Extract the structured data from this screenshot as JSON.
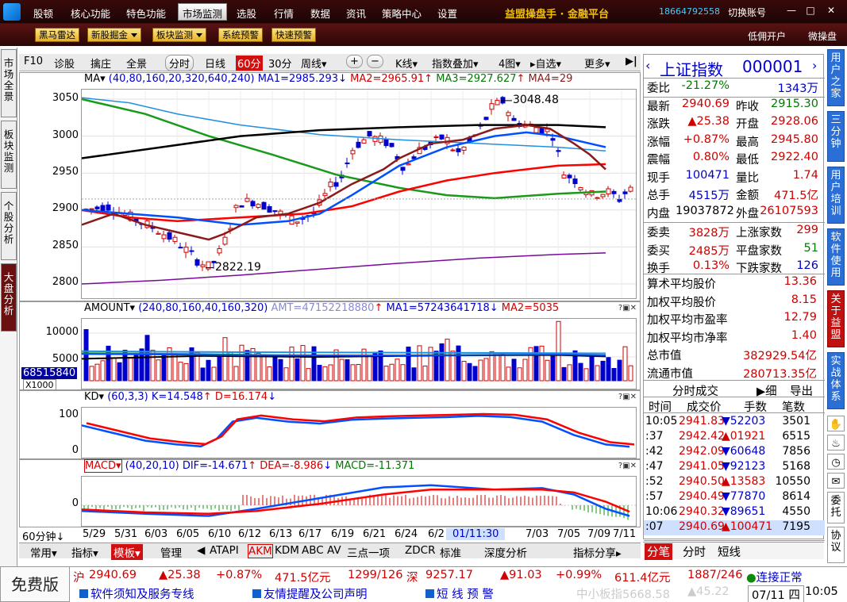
{
  "menu": {
    "items": [
      "行情",
      "核心功能",
      "特色功能",
      "市场监测",
      "选股",
      "行情",
      "数据",
      "资讯",
      "策略中心",
      "设置"
    ],
    "active_index": 3,
    "brand": "益盟操盘手 · 金融平台",
    "phone": "18664792558",
    "account": "切换账号",
    "first_label": "股顿"
  },
  "toolbar2": {
    "buttons": [
      "黑马雷达",
      "新股掘金",
      "板块监测",
      "系统预警",
      "快速预警"
    ],
    "right_links": [
      "低佣开户",
      "微操盘"
    ]
  },
  "left_tabs": [
    "市场全景",
    "板块监测",
    "个股分析",
    "大盘分析"
  ],
  "right_tabs": [
    "用户之家",
    "三分钟",
    "用户培训",
    "软件使用",
    "关于益盟",
    "实战体系",
    "委托",
    "协议"
  ],
  "chart_toolbar": {
    "items": [
      "F10",
      "诊股",
      "擒庄",
      "全景",
      "分时",
      "日线",
      "60分",
      "30分",
      "周线",
      "+",
      "−",
      "K线",
      "指数叠加",
      "4图",
      "自选",
      "更多"
    ],
    "active": "60分"
  },
  "main_panel": {
    "title_prefix": "MA",
    "params": "(40,80,160,20,320,640,240)",
    "ma_labels": [
      "MA1=2985.293",
      "MA2=2965.91",
      "MA3=2927.627",
      "MA4=29"
    ],
    "y_ticks": [
      "3050",
      "3000",
      "2950",
      "2900",
      "2850",
      "2800"
    ],
    "high_label": "3048.48",
    "low_label": "2822.19"
  },
  "amount_panel": {
    "title": "AMOUNT",
    "params": "(240,80,160,40,160,320)",
    "labels": [
      "AMT=47152218880",
      "MA1=57243641718",
      "MA2=5035"
    ],
    "y_ticks": [
      "10000",
      "5000"
    ],
    "unit_value": "68515840",
    "unit": "X1000"
  },
  "kd_panel": {
    "title": "KD",
    "params": "(60,3,3)",
    "labels": [
      "K=14.548",
      "D=16.174"
    ],
    "y_ticks": [
      "100",
      "0"
    ]
  },
  "macd_panel": {
    "title": "MACD",
    "params": "(40,20,10)",
    "labels": [
      "DIF=-14.671",
      "DEA=-8.986",
      "MACD=-11.371"
    ],
    "y_ticks": [
      "0"
    ]
  },
  "x_axis": {
    "period": "60分钟",
    "labels": [
      "5/29",
      "5/31",
      "6/03",
      "6/05",
      "6/10",
      "6/12",
      "6/13",
      "6/17",
      "6/19",
      "6/21",
      "6/24",
      "6/2",
      "01/11:30",
      "7/03",
      "7/05",
      "7/09",
      "7/11"
    ]
  },
  "bottom_tabs": [
    "常用",
    "指标",
    "模板",
    "管理",
    "ATAPI",
    "AKM",
    "KDM",
    "ABC",
    "AV",
    "三点一项",
    "ZDCR",
    "标准",
    "深度分析",
    "指标分享"
  ],
  "quote": {
    "name": "上证指数",
    "code": "000001",
    "rows": [
      {
        "l1": "委比",
        "v1": "-21.27%",
        "l2": "",
        "v2": "1343万"
      },
      {
        "l1": "最新",
        "v1": "2940.69",
        "l2": "昨收",
        "v2": "2915.30"
      },
      {
        "l1": "涨跌",
        "v1": "▲25.38",
        "l2": "开盘",
        "v2": "2928.06"
      },
      {
        "l1": "涨幅",
        "v1": "+0.87%",
        "l2": "最高",
        "v2": "2945.80"
      },
      {
        "l1": "震幅",
        "v1": "0.80%",
        "l2": "最低",
        "v2": "2922.40"
      },
      {
        "l1": "现手",
        "v1": "100471",
        "l2": "量比",
        "v2": "1.74"
      },
      {
        "l1": "总手",
        "v1": "4515万",
        "l2": "金额",
        "v2": "471.5亿"
      },
      {
        "l1": "内盘",
        "v1": "19037872",
        "l2": "外盘",
        "v2": "26107593"
      },
      {
        "l1": "委卖",
        "v1": "3828万",
        "l2": "上涨家数",
        "v2": "299"
      },
      {
        "l1": "委买",
        "v1": "2485万",
        "l2": "平盘家数",
        "v2": "51"
      },
      {
        "l1": "换手",
        "v1": "0.13%",
        "l2": "下跌家数",
        "v2": "126"
      }
    ],
    "stats": [
      {
        "l": "算术平均股价",
        "v": "13.36"
      },
      {
        "l": "加权平均股价",
        "v": "8.15"
      },
      {
        "l": "加权平均市盈率",
        "v": "12.79"
      },
      {
        "l": "加权平均市净率",
        "v": "1.40"
      },
      {
        "l": "总市值",
        "v": "382929.54亿"
      },
      {
        "l": "流通市值",
        "v": "280713.35亿"
      }
    ],
    "ticks_tab": "分时成交",
    "ticks_btns": [
      "细",
      "导出"
    ],
    "ticks_headers": [
      "时间",
      "成交价",
      "手数",
      "笔数"
    ],
    "ticks": [
      {
        "t": "10:05",
        "p": "2941.83",
        "h": "52203",
        "n": "3501"
      },
      {
        "t": ":37",
        "p": "2942.42",
        "h": "01921",
        "n": "6515"
      },
      {
        "t": ":42",
        "p": "2942.09",
        "h": "60648",
        "n": "7856"
      },
      {
        "t": ":47",
        "p": "2941.05",
        "h": "92123",
        "n": "5168"
      },
      {
        "t": ":52",
        "p": "2940.50",
        "h": "13583",
        "n": "10550"
      },
      {
        "t": ":57",
        "p": "2940.49",
        "h": "77870",
        "n": "8614"
      },
      {
        "t": "10:06",
        "p": "2940.32",
        "h": "89651",
        "n": "4550"
      },
      {
        "t": ":07",
        "p": "2940.69",
        "h": "100471",
        "n": "7195"
      }
    ],
    "bottom_tabs": [
      "分笔",
      "分时",
      "短线"
    ]
  },
  "status1": {
    "sh_label": "沪",
    "sh_price": "2940.69",
    "sh_chg": "▲25.38",
    "sh_pct": "+0.87%",
    "sh_amt": "471.5亿元",
    "sh_ud": "1299/126",
    "sz_label": "深",
    "sz_price": "9257.17",
    "sz_chg": "▲91.03",
    "sz_pct": "+0.99%",
    "sz_amt": "611.4亿元",
    "sz_ud": "1887/246",
    "conn": "连接正常"
  },
  "status2": {
    "free": "免费版",
    "links": [
      "软件须知及服务专线",
      "友情提醒及公司声明",
      "短 线 预 警"
    ],
    "ticker": "中小板指5668.58",
    "ticker_chg": "▲45.22",
    "date": "07/11 四",
    "time": "10:05"
  },
  "colors": {
    "up": "#d00000",
    "down": "#0000cc",
    "ma_black": "#000000",
    "ma_brown": "#8b1a1a",
    "ma_green": "#1a9a1a",
    "ma_red": "#ff0000",
    "ma_blue": "#0050ff",
    "ma_purple": "#7a0a9a",
    "ma_lightblue": "#2090e0"
  }
}
